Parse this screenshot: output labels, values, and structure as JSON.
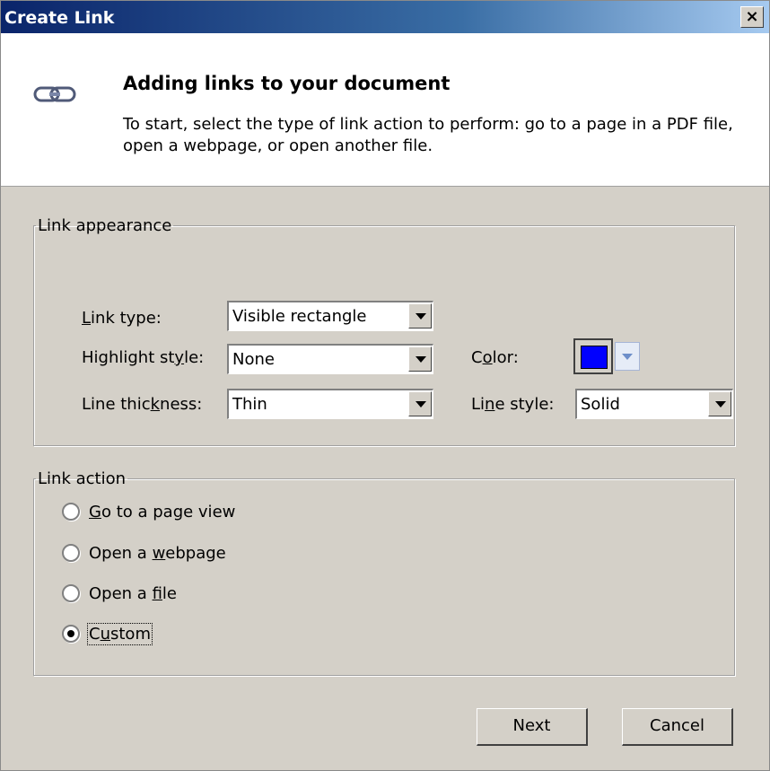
{
  "window": {
    "title": "Create Link",
    "close_label": "×"
  },
  "header": {
    "heading": "Adding links to your document",
    "description": "To start, select the type of link action to perform: go to a page in a PDF file, open a webpage, or open another file."
  },
  "appearance": {
    "legend": "Link appearance",
    "link_type": {
      "label_pre": "",
      "label_u": "L",
      "label_post": "ink type:",
      "value": "Visible rectangle"
    },
    "highlight_style": {
      "label_pre": "Highlight st",
      "label_u": "y",
      "label_post": "le:",
      "value": "None"
    },
    "line_thickness": {
      "label_pre": "Line thic",
      "label_u": "k",
      "label_post": "ness:",
      "value": "Thin"
    },
    "color": {
      "label_pre": "C",
      "label_u": "o",
      "label_post": "lor:",
      "value": "#0000ff"
    },
    "line_style": {
      "label_pre": "Li",
      "label_u": "n",
      "label_post": "e style:",
      "value": "Solid"
    }
  },
  "action": {
    "legend": "Link action",
    "options": [
      {
        "pre": "",
        "u": "G",
        "post": "o to a page view",
        "checked": false
      },
      {
        "pre": "Open a ",
        "u": "w",
        "post": "ebpage",
        "checked": false
      },
      {
        "pre": "Open a ",
        "u": "f",
        "post": "ile",
        "checked": false
      },
      {
        "pre": "C",
        "u": "u",
        "post": "stom",
        "checked": true
      }
    ]
  },
  "buttons": {
    "next": "Next",
    "cancel": "Cancel"
  }
}
